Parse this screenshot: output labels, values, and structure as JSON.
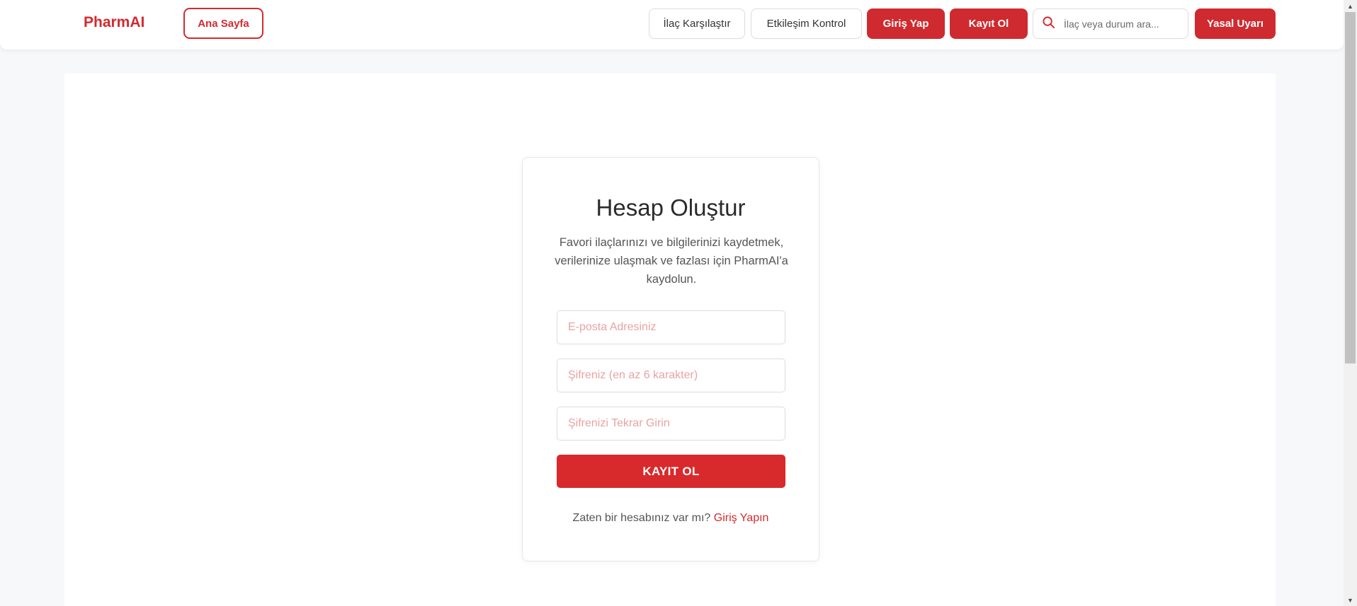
{
  "navbar": {
    "brand": "PharmAI",
    "home_label": "Ana Sayfa",
    "compare_label": "İlaç Karşılaştır",
    "interaction_label": "Etkileşim Kontrol",
    "login_label": "Giriş Yap",
    "register_label": "Kayıt Ol",
    "search_placeholder": "İlaç veya durum ara...",
    "legal_label": "Yasal Uyarı"
  },
  "signup": {
    "title": "Hesap Oluştur",
    "description": "Favori ilaçlarınızı ve bilgilerinizi kaydetmek, verilerinize ulaşmak ve fazlası için PharmAI'a kaydolun.",
    "email_placeholder": "E-posta Adresiniz",
    "password_placeholder": "Şifreniz (en az 6 karakter)",
    "password_confirm_placeholder": "Şifrenizi Tekrar Girin",
    "submit_label": "KAYIT OL",
    "have_account_text": "Zaten bir hesabınız var mı?",
    "login_link": "Giriş Yapın"
  },
  "colors": {
    "accent": "#d42a2f",
    "page_background": "#f7f8fa"
  },
  "icons": {
    "search": "search-icon",
    "scroll_up": "scroll-up-arrow-icon",
    "scroll_down": "scroll-down-arrow-icon"
  }
}
